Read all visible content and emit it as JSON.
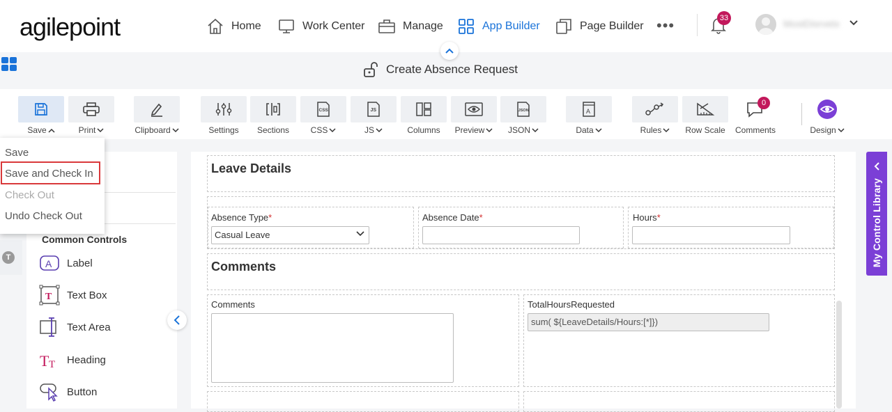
{
  "brand": {
    "logo_text": "agilepoint"
  },
  "nav": {
    "items": [
      {
        "label": "Home",
        "icon": "home-icon"
      },
      {
        "label": "Work Center",
        "icon": "monitor-icon"
      },
      {
        "label": "Manage",
        "icon": "briefcase-icon"
      },
      {
        "label": "App Builder",
        "icon": "grid-icon",
        "active": true
      },
      {
        "label": "Page Builder",
        "icon": "pages-icon"
      }
    ],
    "more": "•••",
    "notification_count": "33",
    "user_name": "MostDisrvetx"
  },
  "form": {
    "title": "Create Absence Request"
  },
  "toolbar": {
    "items": [
      {
        "label": "Save",
        "dropdown": true
      },
      {
        "label": "Print",
        "dropdown": true
      },
      {
        "label": "Clipboard",
        "dropdown": true
      },
      {
        "label": "Settings"
      },
      {
        "label": "Sections"
      },
      {
        "label": "CSS",
        "dropdown": true
      },
      {
        "label": "JS",
        "dropdown": true
      },
      {
        "label": "Columns"
      },
      {
        "label": "Preview",
        "dropdown": true
      },
      {
        "label": "JSON",
        "dropdown": true
      },
      {
        "label": "Data",
        "dropdown": true
      },
      {
        "label": "Rules",
        "dropdown": true
      },
      {
        "label": "Row Scale"
      },
      {
        "label": "Comments"
      },
      {
        "label": "Design",
        "dropdown": true
      }
    ],
    "comments_badge": "0"
  },
  "save_menu": {
    "items": [
      {
        "label": "Save"
      },
      {
        "label": "Save and Check In",
        "highlighted": true
      },
      {
        "label": "Check Out",
        "disabled": true
      },
      {
        "label": "Undo Check Out"
      }
    ]
  },
  "left_panel": {
    "section_title": "Common Controls",
    "controls": [
      {
        "label": "Label",
        "icon": "label-icon"
      },
      {
        "label": "Text Box",
        "icon": "textbox-icon"
      },
      {
        "label": "Text Area",
        "icon": "textarea-icon"
      },
      {
        "label": "Heading",
        "icon": "heading-icon"
      },
      {
        "label": "Button",
        "icon": "button-icon"
      }
    ],
    "t_badge": "T"
  },
  "canvas": {
    "leave_details_title": "Leave Details",
    "absence_type_label": "Absence Type",
    "absence_type_value": "Casual Leave",
    "absence_date_label": "Absence Date",
    "hours_label": "Hours",
    "required_mark": "*",
    "comments_title": "Comments",
    "comments_label": "Comments",
    "total_hours_label": "TotalHoursRequested",
    "total_hours_value": "sum( ${LeaveDetails/Hours:[*]})"
  },
  "right_tab": {
    "label": "My Control Library"
  },
  "colors": {
    "accent": "#1a73d9",
    "brand_purple": "#7b3fd6",
    "badge": "#c2185b",
    "highlight_border": "#d9383a"
  }
}
